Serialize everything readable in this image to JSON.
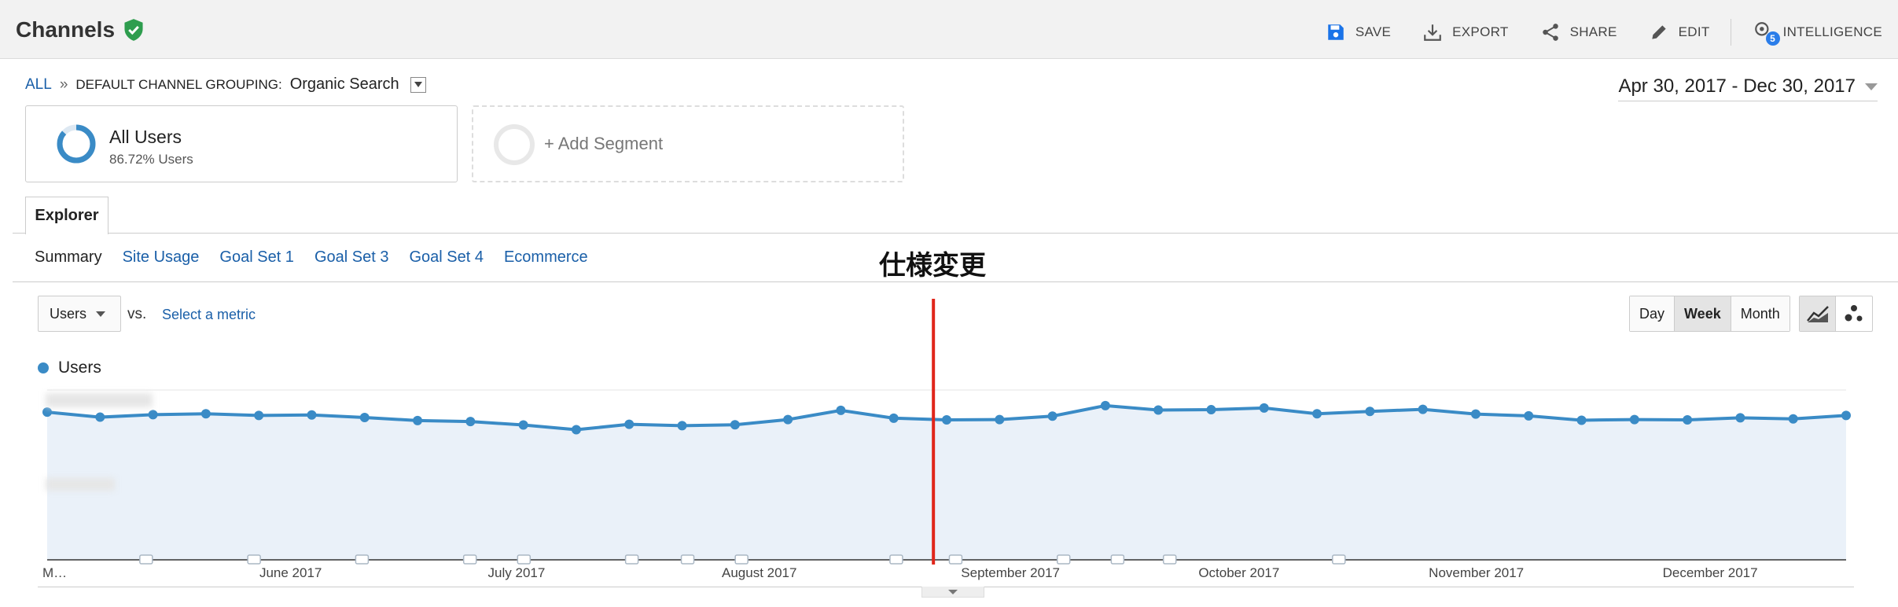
{
  "header": {
    "title": "Channels",
    "actions": {
      "save": "SAVE",
      "export": "EXPORT",
      "share": "SHARE",
      "edit": "EDIT",
      "intelligence": "INTELLIGENCE",
      "intelligence_badge": "5"
    }
  },
  "breadcrumb": {
    "all": "ALL",
    "separator": "»",
    "grouping": "DEFAULT CHANNEL GROUPING:",
    "value": "Organic Search"
  },
  "date_range": "Apr 30, 2017 - Dec 30, 2017",
  "segments": {
    "all_users": {
      "name": "All Users",
      "sub": "86.72% Users",
      "percent": 86.72
    },
    "add": "+ Add Segment"
  },
  "tabs": {
    "explorer": "Explorer"
  },
  "subtabs": [
    "Summary",
    "Site Usage",
    "Goal Set 1",
    "Goal Set 3",
    "Goal Set 4",
    "Ecommerce"
  ],
  "annotation": "仕様変更",
  "metric": {
    "selected": "Users",
    "vs": "vs.",
    "select_metric": "Select a metric"
  },
  "period": {
    "day": "Day",
    "week": "Week",
    "month": "Month",
    "selected": "Week"
  },
  "colors": {
    "accent": "#3a8bc6",
    "fill": "#eaf1f9",
    "marker": "#e0261b",
    "link": "#1a5fa8",
    "badge_green": "#2e9d4e"
  },
  "chart_data": {
    "type": "area",
    "series": [
      {
        "name": "Users",
        "values": [
          87,
          84,
          85.5,
          86,
          85,
          85.3,
          83.8,
          82,
          81.4,
          79.4,
          76.6,
          79.8,
          79,
          79.5,
          82.6,
          88,
          83.4,
          82.4,
          82.6,
          84.6,
          90.8,
          88.2,
          88.4,
          89.4,
          86,
          87.4,
          88.6,
          85.8,
          84.8,
          82.2,
          82.6,
          82.4,
          83.6,
          83,
          85
        ]
      }
    ],
    "x_labels": [
      "M…",
      "June 2017",
      "July 2017",
      "August 2017",
      "September 2017",
      "October 2017",
      "November 2017",
      "December 2017"
    ],
    "ylim": [
      0,
      100
    ],
    "grid": true,
    "annotation_markers": 19,
    "vertical_marker_index": 16.75
  }
}
